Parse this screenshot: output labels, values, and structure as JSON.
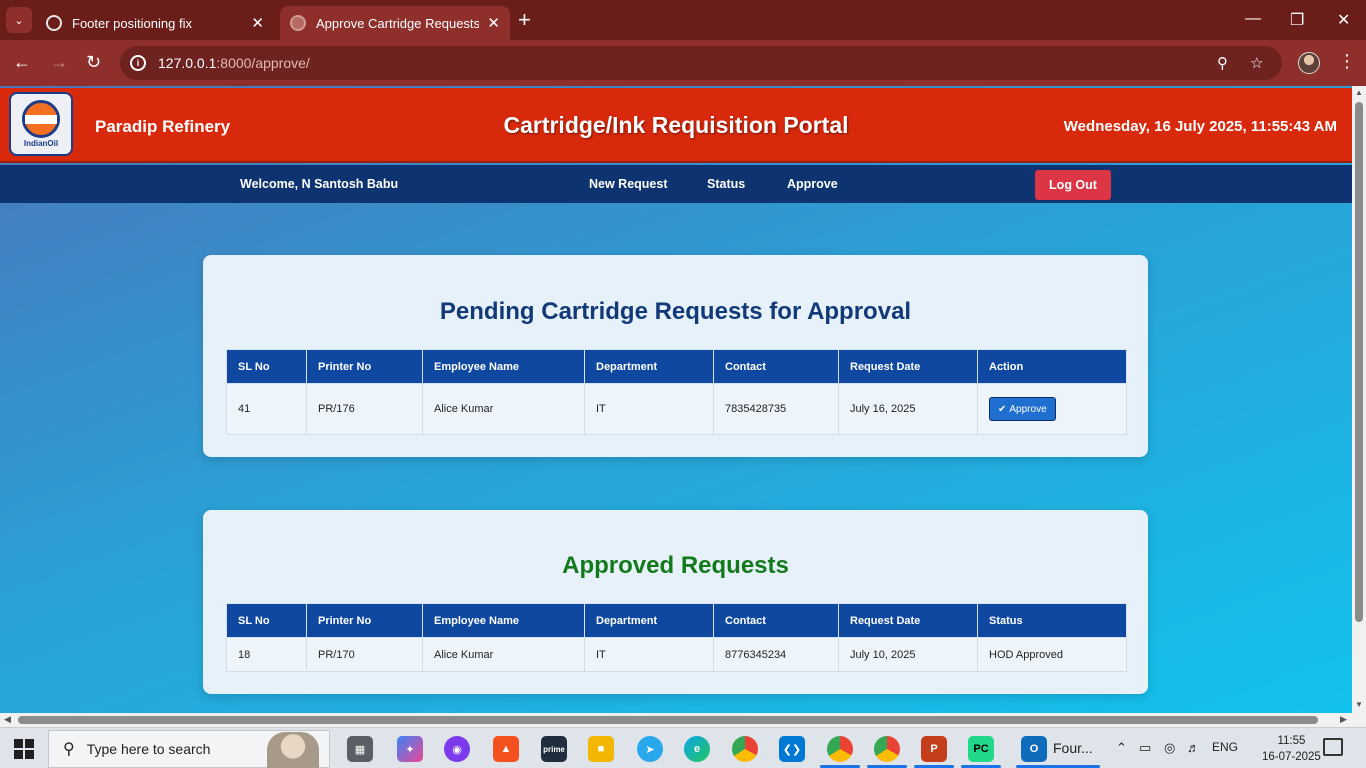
{
  "browser": {
    "tabs": [
      {
        "title": "Footer positioning fix",
        "active": false
      },
      {
        "title": "Approve Cartridge Requests",
        "active": true
      }
    ],
    "url_host": "127.0.0.1",
    "url_path": ":8000/approve/",
    "accent": "#8e2f2b"
  },
  "header": {
    "logo_text": "IndianOil",
    "org_name": "Paradip Refinery",
    "portal_title": "Cartridge/Ink Requisition Portal",
    "datetime": "Wednesday, 16 July 2025, 11:55:43 AM",
    "color": "#d9290c"
  },
  "nav": {
    "welcome": "Welcome, N Santosh Babu",
    "links": [
      "New Request",
      "Status",
      "Approve"
    ],
    "logout_label": "Log Out"
  },
  "pending": {
    "title": "Pending Cartridge Requests for Approval",
    "columns": [
      "SL No",
      "Printer No",
      "Employee Name",
      "Department",
      "Contact",
      "Request Date",
      "Action"
    ],
    "rows": [
      {
        "sl": "41",
        "printer": "PR/176",
        "name": "Alice Kumar",
        "dept": "IT",
        "contact": "7835428735",
        "date": "July 16, 2025",
        "action": "Approve"
      }
    ]
  },
  "approved": {
    "title": "Approved Requests",
    "columns": [
      "SL No",
      "Printer No",
      "Employee Name",
      "Department",
      "Contact",
      "Request Date",
      "Status"
    ],
    "rows": [
      {
        "sl": "18",
        "printer": "PR/170",
        "name": "Alice Kumar",
        "dept": "IT",
        "contact": "8776345234",
        "date": "July 10, 2025",
        "status": "HOD Approved"
      }
    ]
  },
  "taskbar": {
    "search_placeholder": "Type here to search",
    "outlook_label": "Four...",
    "lang": "ENG",
    "time": "11:55",
    "date": "16-07-2025"
  }
}
